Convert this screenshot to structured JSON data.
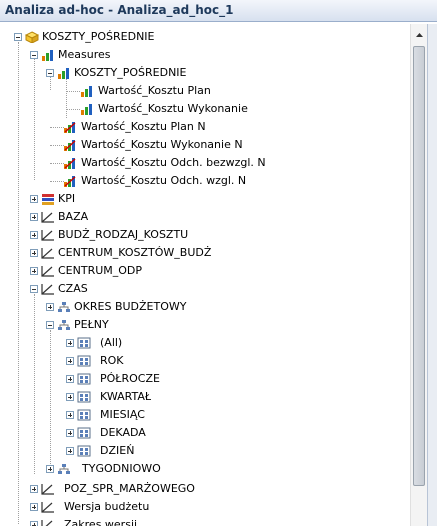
{
  "window": {
    "title": "Analiza ad-hoc - Analiza_ad_hoc_1"
  },
  "tree": {
    "root": "KOSZTY_POŚREDNIE",
    "measures": "Measures",
    "measure_group": "KOSZTY_POŚREDNIE",
    "measure_items": [
      "Wartość_Kosztu Plan",
      "Wartość_Kosztu Wykonanie"
    ],
    "calc_items": [
      "Wartość_Kosztu Plan N",
      "Wartość_Kosztu Wykonanie N",
      "Wartość_Kosztu Odch. bezwzgl. N",
      "Wartość_Kosztu Odch. wzgl. N"
    ],
    "kpi": "KPI",
    "dims_a": [
      "BAZA",
      "BUDŻ_RODZAJ_KOSZTU",
      "CENTRUM_KOSZTÓW_BUDŻ",
      "CENTRUM_ODP"
    ],
    "czas": "CZAS",
    "hier_okres": "OKRES BUDŻETOWY",
    "hier_pelny": "PEŁNY",
    "levels": [
      "(All)",
      "ROK",
      "PÓŁROCZE",
      "KWARTAŁ",
      "MIESIĄC",
      "DEKADA",
      "DZIEŃ"
    ],
    "hier_tyg": "TYGODNIOWO",
    "dims_b": [
      "POZ_SPR_MARŻOWEGO",
      "Wersja budżetu"
    ],
    "partial_item": "Zakres wersji"
  },
  "icons": {
    "cube": "cube-icon",
    "measures": "measures-icon",
    "measure": "measure-icon",
    "calc_measure": "calculated-measure-icon",
    "kpi": "kpi-icon",
    "dimension": "dimension-icon",
    "hierarchy": "hierarchy-icon",
    "level": "level-icon"
  },
  "colors": {
    "title_text": "#1e395b",
    "title_bg": "#dbe4f1"
  }
}
